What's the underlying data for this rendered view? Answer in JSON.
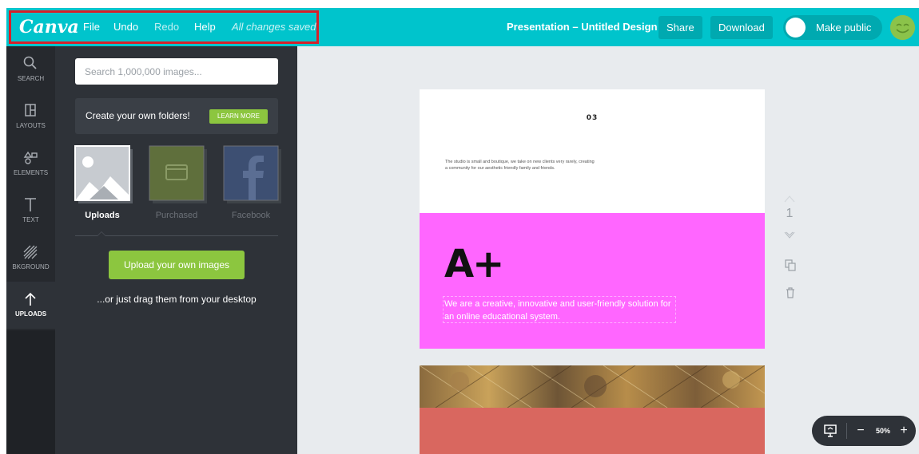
{
  "topbar": {
    "logo": "Canva",
    "menu": [
      {
        "label": "File"
      },
      {
        "label": "Undo"
      },
      {
        "label": "Redo"
      },
      {
        "label": "Help"
      }
    ],
    "save_status": "All changes saved",
    "doc_title": "Presentation – Untitled Design",
    "share_label": "Share",
    "download_label": "Download",
    "public_label": "Make public",
    "accent_color": "#00c4cc",
    "highlight_color": "#d6202a"
  },
  "rail": {
    "items": [
      {
        "label": "SEARCH",
        "icon": "search-icon"
      },
      {
        "label": "LAYOUTS",
        "icon": "layouts-icon"
      },
      {
        "label": "ELEMENTS",
        "icon": "elements-icon"
      },
      {
        "label": "TEXT",
        "icon": "text-icon"
      },
      {
        "label": "BKGROUND",
        "icon": "background-icon"
      },
      {
        "label": "UPLOADS",
        "icon": "upload-icon",
        "active": true
      }
    ]
  },
  "panel": {
    "search_placeholder": "Search 1,000,000 images...",
    "folders_text": "Create your own folders!",
    "learn_more": "LEARN MORE",
    "sources": [
      {
        "label": "Uploads",
        "active": true
      },
      {
        "label": "Purchased"
      },
      {
        "label": "Facebook"
      }
    ],
    "upload_button": "Upload your own images",
    "drag_text": "...or just drag them from your desktop"
  },
  "canvas": {
    "page1": {
      "number": "03",
      "body": "The studio is small and boutique, we take on new clients very rarely, creating a community for our aesthetic friendly family and friends."
    },
    "page2": {
      "heading": "A+",
      "body": "We are a creative, innovative and user-friendly solution for an online educational system.",
      "bg_color": "#ff66ff"
    },
    "page3": {
      "bg_color": "#d9675f"
    },
    "page_number": "1"
  },
  "zoom": {
    "value": "50%",
    "minus": "−",
    "plus": "+"
  }
}
